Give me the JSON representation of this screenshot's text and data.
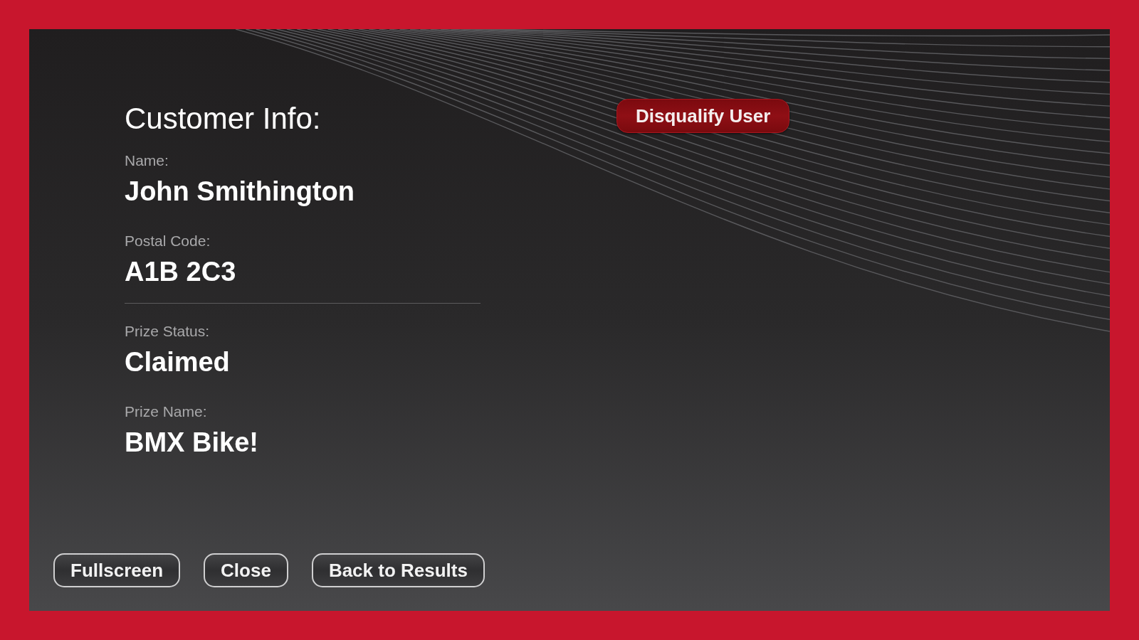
{
  "heading": "Customer Info:",
  "disqualify_button": "Disqualify User",
  "customer_fields": [
    {
      "label": "Name:",
      "value": "John Smithington"
    },
    {
      "label": "Postal Code:",
      "value": "A1B 2C3"
    }
  ],
  "prize_fields": [
    {
      "label": "Prize Status:",
      "value": "Claimed"
    },
    {
      "label": "Prize Name:",
      "value": "BMX Bike!"
    }
  ],
  "footer_buttons": [
    "Fullscreen",
    "Close",
    "Back to Results"
  ]
}
